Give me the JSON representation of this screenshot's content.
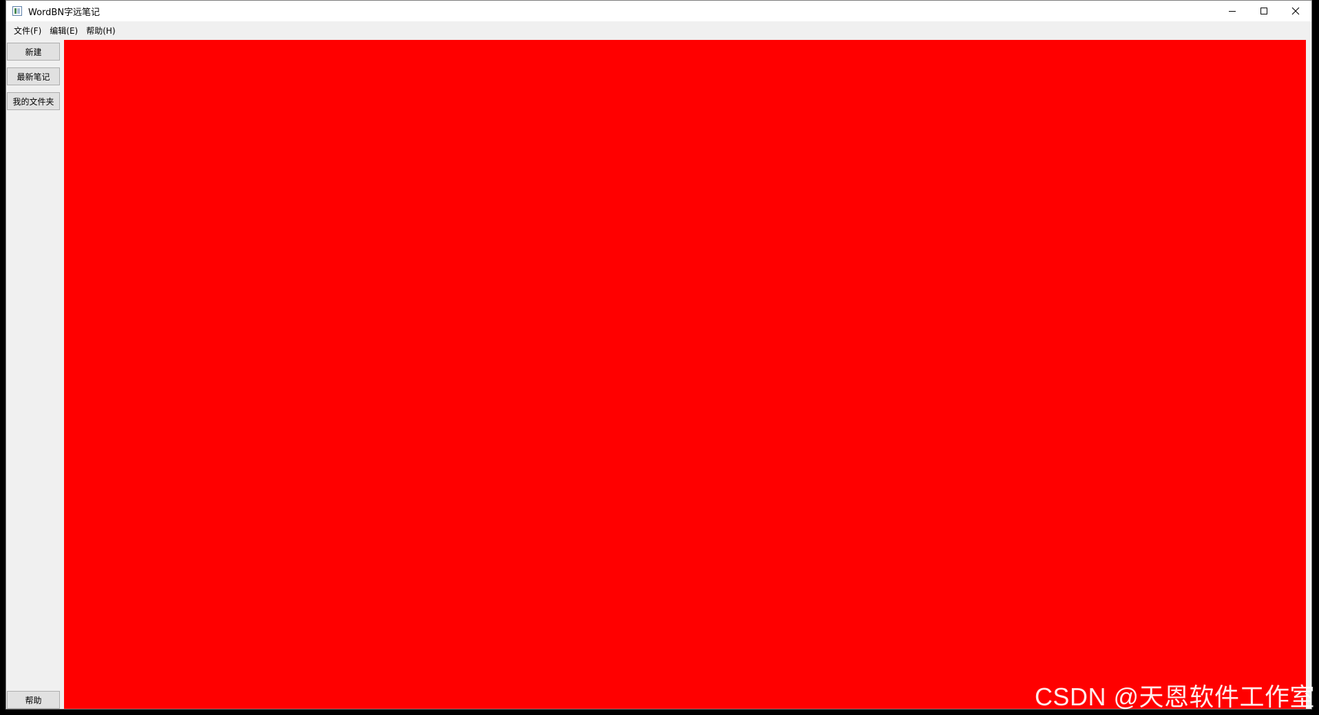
{
  "window": {
    "title": "WordBN字远笔记"
  },
  "menubar": {
    "items": [
      {
        "label": "文件(F)"
      },
      {
        "label": "编辑(E)"
      },
      {
        "label": "帮助(H)"
      }
    ]
  },
  "sidebar": {
    "new_label": "新建",
    "recent_label": "最新笔记",
    "folders_label": "我的文件夹",
    "help_label": "帮助"
  },
  "content": {
    "background_color": "#ff0000"
  },
  "watermark": {
    "text": "CSDN @天恩软件工作室"
  }
}
